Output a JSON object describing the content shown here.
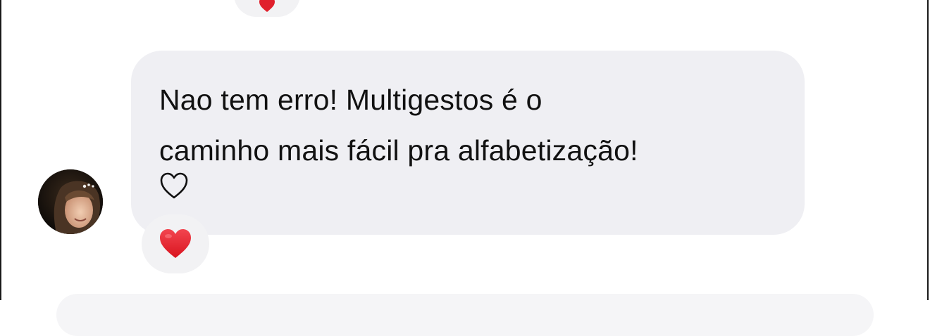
{
  "message": {
    "lines": [
      "Nao tem erro! Multigestos é o",
      "caminho mais fácil pra alfabetização!"
    ]
  },
  "reaction": {
    "emoji": "red-heart",
    "color": "#e0202c"
  },
  "like_icon": "heart-outline-icon",
  "colors": {
    "bubble_background": "#efeff3",
    "reaction_background": "#f2f2f4",
    "text": "#111111"
  }
}
